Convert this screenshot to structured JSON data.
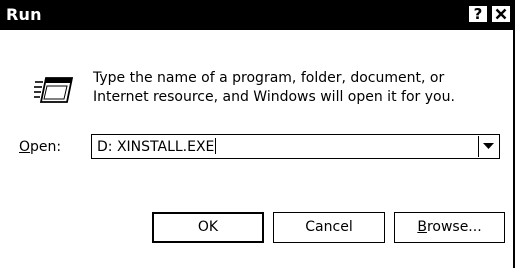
{
  "window": {
    "title": "Run",
    "help_button": "?",
    "close_button": "✕"
  },
  "icon": "run-icon",
  "prompt": {
    "line1": "Type the name of a program, folder, document, or",
    "line2": "Internet resource, and Windows will open it for you."
  },
  "open_field": {
    "label_mnemonic": "O",
    "label_rest": "pen:",
    "value": "D: XINSTALL.EXE",
    "dropdown_icon": "chevron-down-icon"
  },
  "buttons": {
    "ok": "OK",
    "cancel": "Cancel",
    "browse_mnemonic": "B",
    "browse_rest": "rowse..."
  }
}
